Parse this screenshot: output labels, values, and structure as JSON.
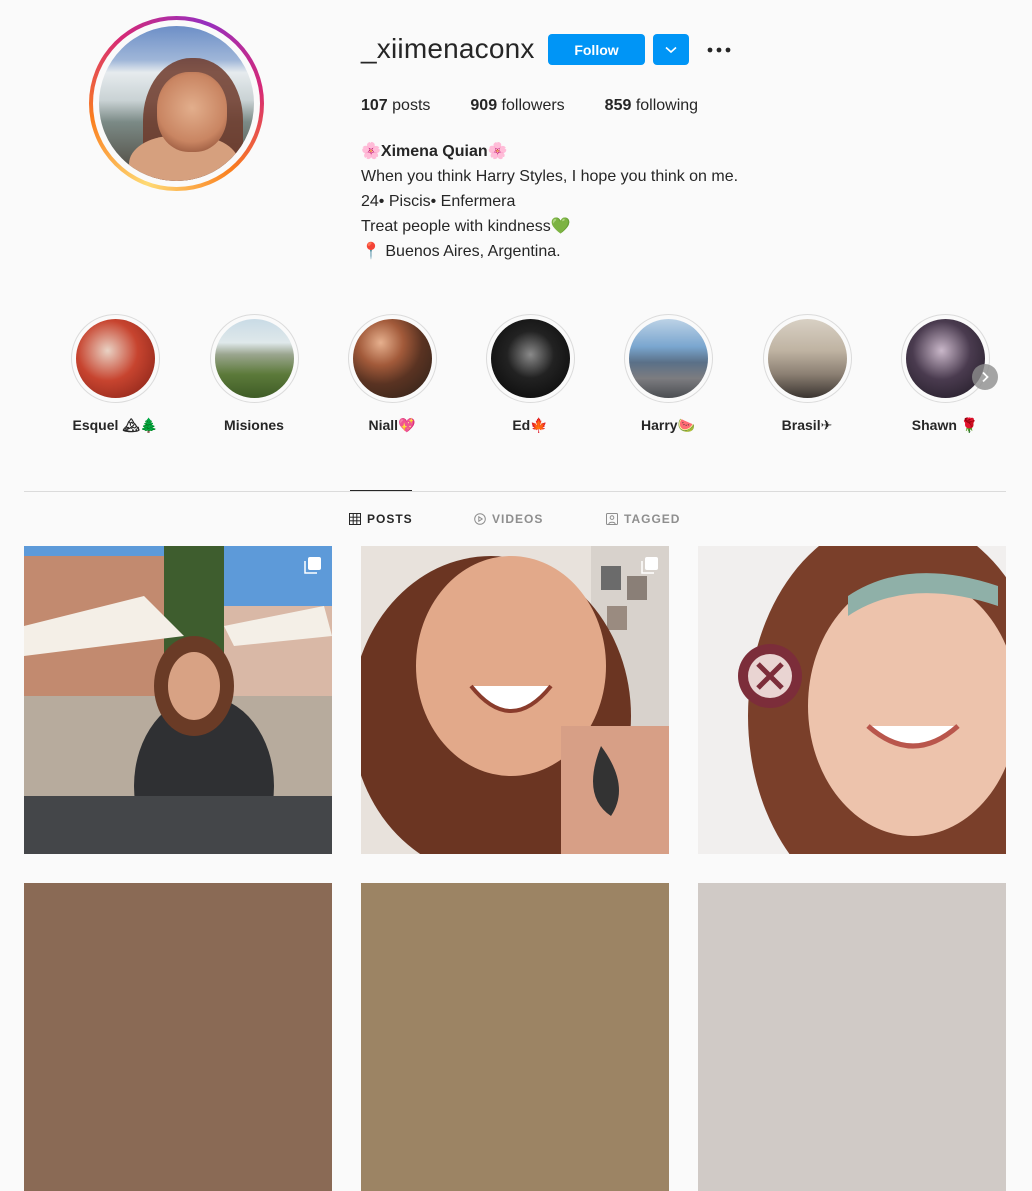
{
  "profile": {
    "username": "_xiimenaconx",
    "follow_label": "Follow",
    "stats": [
      {
        "count": "107",
        "label": " posts"
      },
      {
        "count": "909",
        "label": " followers"
      },
      {
        "count": "859",
        "label": " following"
      }
    ],
    "bio": {
      "name": "🌸Ximena Quian🌸",
      "lines": [
        "When you think Harry Styles, I hope you think on me.",
        "24• Piscis• Enfermera",
        "Treat people with kindness💚",
        "📍 Buenos Aires, Argentina."
      ]
    }
  },
  "highlights": [
    {
      "label": "Esquel 🏔🌲"
    },
    {
      "label": "Misiones"
    },
    {
      "label": "Niall💖"
    },
    {
      "label": "Ed🍁"
    },
    {
      "label": "Harry🍉"
    },
    {
      "label": "Brasil✈"
    },
    {
      "label": "Shawn 🌹"
    }
  ],
  "tabs": [
    {
      "label": "POSTS",
      "icon": "grid-icon",
      "active": true
    },
    {
      "label": "VIDEOS",
      "icon": "play-circle-icon",
      "active": false
    },
    {
      "label": "TAGGED",
      "icon": "tag-person-icon",
      "active": false
    }
  ],
  "colors": {
    "accent": "#0095f6",
    "text": "#262626",
    "muted": "#8e8e8e",
    "border": "#dbdbdb"
  }
}
